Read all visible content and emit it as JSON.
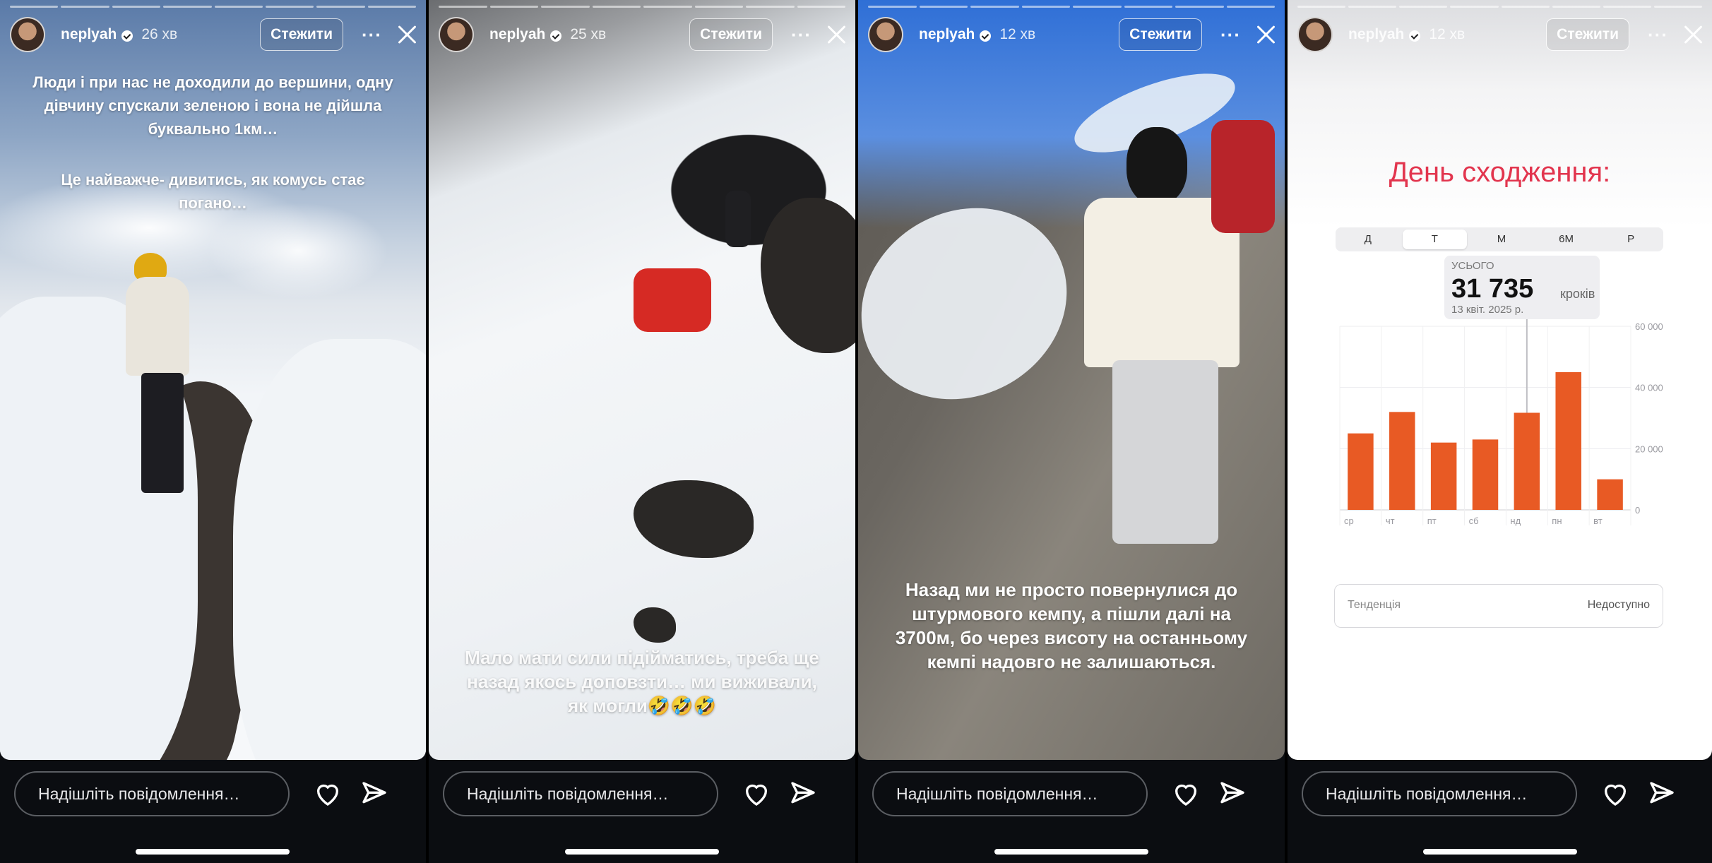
{
  "stories": [
    {
      "username": "neplyah",
      "time": "26 хв",
      "follow_label": "Стежити",
      "more": "···",
      "caption1": "Люди і при нас не доходили до вершини, одну дівчину спускали зеленою і вона не дійшла буквально 1км…",
      "caption2": "Це найважче- дивитись, як комусь стає погано…",
      "message_placeholder": "Надішліть повідомлення…"
    },
    {
      "username": "neplyah",
      "time": "25 хв",
      "follow_label": "Стежити",
      "more": "···",
      "caption1": "Мало мати сили підійматись, треба ще назад якось доповзти… ми виживали, як могли🤣🤣🤣",
      "message_placeholder": "Надішліть повідомлення…"
    },
    {
      "username": "neplyah",
      "time": "12 хв",
      "follow_label": "Стежити",
      "more": "···",
      "caption1": "Назад ми не просто повернулися до штурмового кемпу, а пішли далі на 3700м, бо через висоту на останньому кемпі надовго не залишаються.",
      "message_placeholder": "Надішліть повідомлення…"
    },
    {
      "username": "neplyah",
      "time": "12 хв",
      "follow_label": "Стежити",
      "more": "···",
      "title": "День сходження:",
      "message_placeholder": "Надішліть повідомлення…"
    }
  ],
  "health": {
    "ranges": [
      "Д",
      "Т",
      "М",
      "6М",
      "Р"
    ],
    "selected_range": "Т",
    "total_label": "УСЬОГО",
    "total_value": "31 735",
    "total_unit": "кроків",
    "date": "13 квіт. 2025 р.",
    "trend_label": "Тенденція",
    "trend_value": "Недоступно",
    "accent": "#e85a24"
  },
  "chart_data": {
    "type": "bar",
    "categories": [
      "ср",
      "чт",
      "пт",
      "сб",
      "нд",
      "пн",
      "вт"
    ],
    "values": [
      25000,
      32000,
      22000,
      23000,
      31735,
      45000,
      10000
    ],
    "ylim": [
      0,
      60000
    ],
    "yticks": [
      "0",
      "20 000",
      "40 000",
      "60 000"
    ],
    "ytick_values": [
      0,
      20000,
      40000,
      60000
    ],
    "highlight_index": 4,
    "grid": true
  }
}
